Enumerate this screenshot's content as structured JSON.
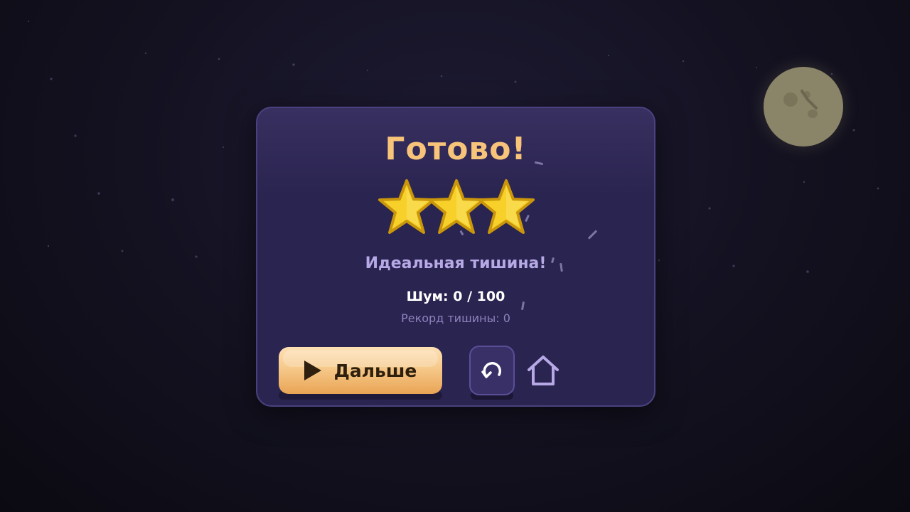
{
  "result": {
    "title": "Готово!",
    "stars_earned": 3,
    "stars_total": 3,
    "subtitle": "Идеальная тишина!",
    "noise_text": "Шум: 0 / 100",
    "record_text": "Рекорд тишины: 0"
  },
  "buttons": {
    "next_label": "Дальше",
    "next_icon": "play-icon",
    "replay_icon": "replay-icon",
    "home_icon": "home-icon"
  },
  "colors": {
    "title": "#f7c47a",
    "star_fill": "#f7d02a",
    "star_outline": "#c9960c",
    "subtitle": "#b7a9e6",
    "next_button": "#f6c98a",
    "card_bg": "#2a2450"
  }
}
